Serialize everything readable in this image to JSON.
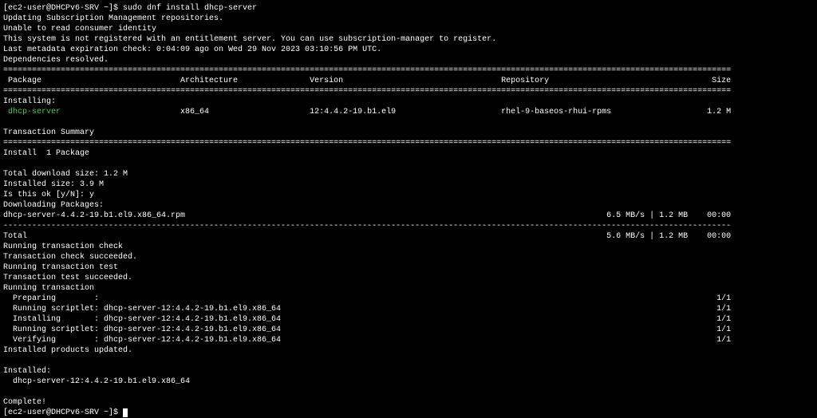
{
  "prompt1": "[ec2-user@DHCPv6-SRV ~]$ ",
  "cmd": "sudo dnf install dhcp-server",
  "l1": "Updating Subscription Management repositories.",
  "l2": "Unable to read consumer identity",
  "l3": "",
  "l4": "This system is not registered with an entitlement server. You can use subscription-manager to register.",
  "l5": "",
  "l6": "Last metadata expiration check: 0:04:09 ago on Wed 29 Nov 2023 03:10:56 PM UTC.",
  "l7": "Dependencies resolved.",
  "divider": "========================================================================================================================================================",
  "hPackage": " Package",
  "hArch": "Architecture",
  "hVersion": "Version",
  "hRepo": "Repository",
  "hSize": "Size",
  "installing": "Installing:",
  "pkgName": " dhcp-server",
  "pkgArch": "x86_64",
  "pkgVersion": "12:4.4.2-19.b1.el9",
  "pkgRepo": "rhel-9-baseos-rhui-rpms",
  "pkgSize": "1.2 M",
  "txSummary": "Transaction Summary",
  "installCount": "Install  1 Package",
  "dlSize": "Total download size: 1.2 M",
  "instSize": "Installed size: 3.9 M",
  "confirm": "Is this ok [y/N]: y",
  "dlPkgs": "Downloading Packages:",
  "rpmName": "dhcp-server-4.4.2-19.b1.el9.x86_64.rpm",
  "rpmSpeed": "6.5 MB/s | 1.2 MB",
  "rpmTime": "00:00",
  "dashLine": "--------------------------------------------------------------------------------------------------------------------------------------------------------",
  "total": "Total",
  "totSpeed": "5.6 MB/s | 1.2 MB",
  "totTime": "00:00",
  "txCheck": "Running transaction check",
  "txCheckOk": "Transaction check succeeded.",
  "txTest": "Running transaction test",
  "txTestOk": "Transaction test succeeded.",
  "txRun": "Running transaction",
  "prep": "  Preparing        :",
  "prepCnt": "1/1",
  "s1": "  Running scriptlet: dhcp-server-12:4.4.2-19.b1.el9.x86_64",
  "s1c": "1/1",
  "s2": "  Installing       : dhcp-server-12:4.4.2-19.b1.el9.x86_64",
  "s2c": "1/1",
  "s3": "  Running scriptlet: dhcp-server-12:4.4.2-19.b1.el9.x86_64",
  "s3c": "1/1",
  "s4": "  Verifying        : dhcp-server-12:4.4.2-19.b1.el9.x86_64",
  "s4c": "1/1",
  "prodUpd": "Installed products updated.",
  "installed": "Installed:",
  "instPkg": "  dhcp-server-12:4.4.2-19.b1.el9.x86_64",
  "complete": "Complete!",
  "prompt2": "[ec2-user@DHCPv6-SRV ~]$ "
}
